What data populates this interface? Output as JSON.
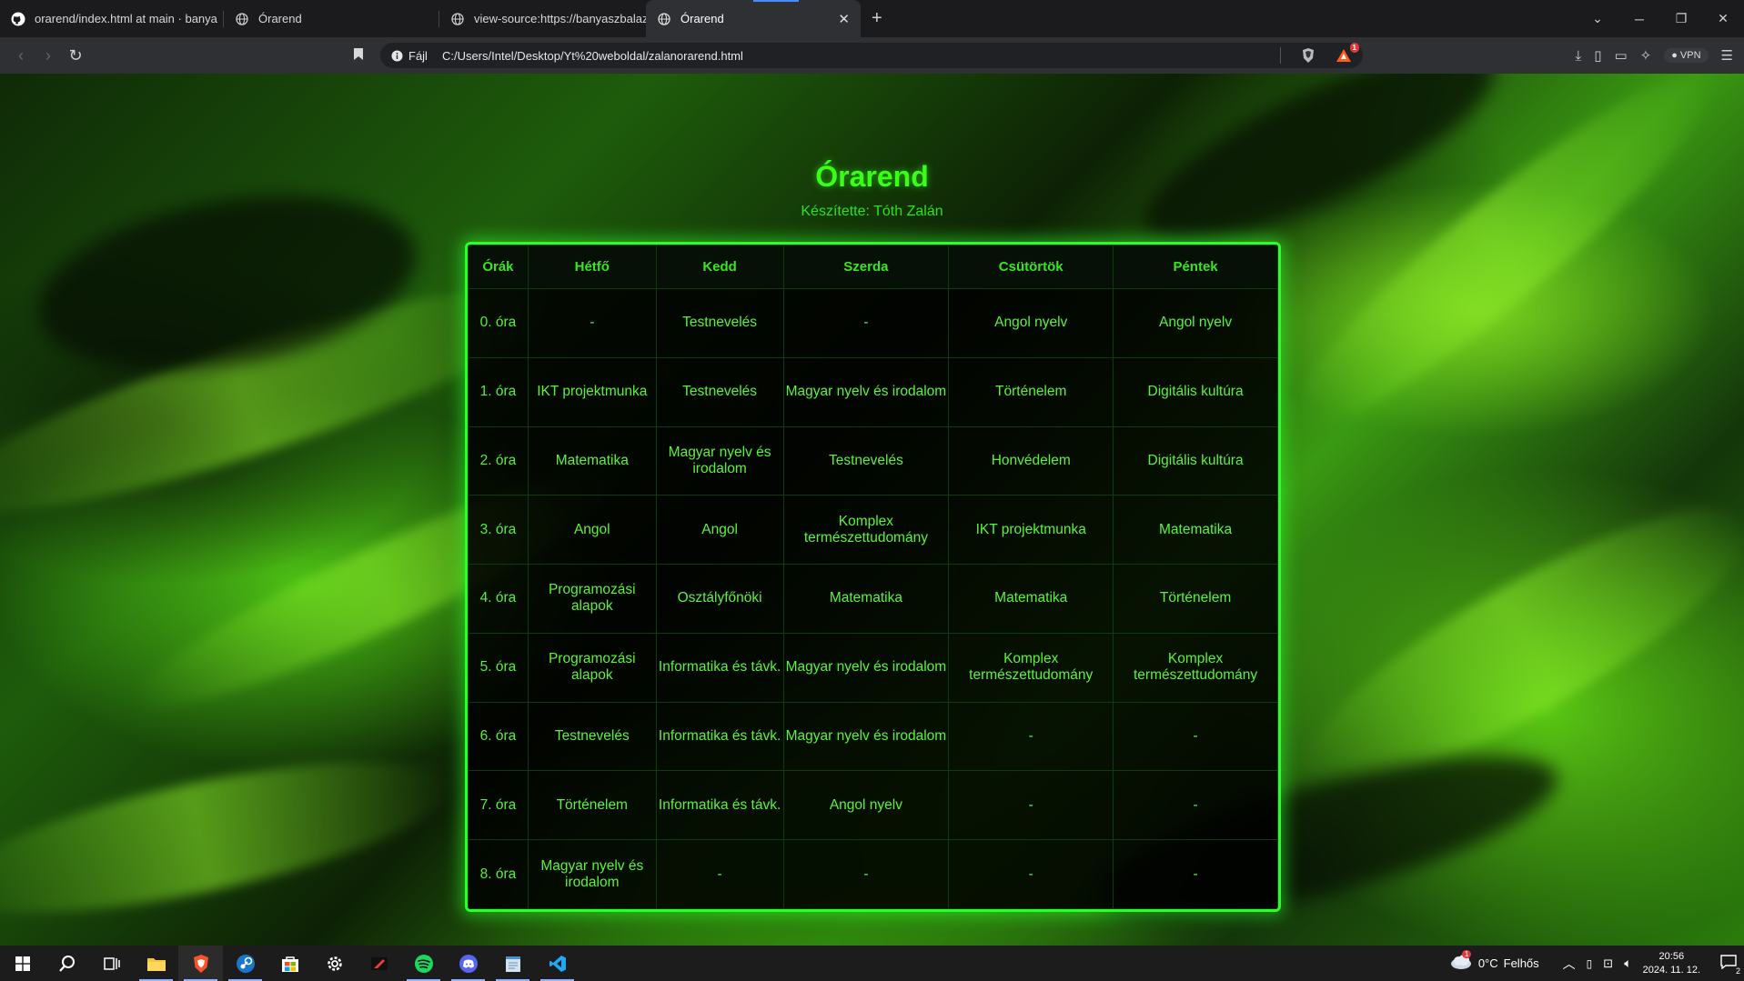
{
  "browser": {
    "tabs": [
      {
        "title": "orarend/index.html at main · banya",
        "icon": "github-icon",
        "active": false
      },
      {
        "title": "Órarend",
        "icon": "globe-icon",
        "active": false
      },
      {
        "title": "view-source:https://banyaszbalazs.g",
        "icon": "globe-icon",
        "active": false
      },
      {
        "title": "Órarend",
        "icon": "globe-icon",
        "active": true
      }
    ],
    "url_chip": "Fájl",
    "url": "C:/Users/Intel/Desktop/Yt%20weboldal/zalanorarend.html",
    "rewards_badge": "1",
    "vpn_label": "VPN"
  },
  "page": {
    "title": "Órarend",
    "subtitle": "Készítette: Tóth Zalán",
    "table": {
      "headers": [
        "Órák",
        "Hétfő",
        "Kedd",
        "Szerda",
        "Csütörtök",
        "Péntek"
      ],
      "rows": [
        [
          "0. óra",
          "-",
          "Testnevelés",
          "-",
          "Angol nyelv",
          "Angol nyelv"
        ],
        [
          "1. óra",
          "IKT projektmunka",
          "Testnevelés",
          "Magyar nyelv és irodalom",
          "Történelem",
          "Digitális kultúra"
        ],
        [
          "2. óra",
          "Matematika",
          "Magyar nyelv és irodalom",
          "Testnevelés",
          "Honvédelem",
          "Digitális kultúra"
        ],
        [
          "3. óra",
          "Angol",
          "Angol",
          "Komplex természettudomány",
          "IKT projektmunka",
          "Matematika"
        ],
        [
          "4. óra",
          "Programozási alapok",
          "Osztályfőnöki",
          "Matematika",
          "Matematika",
          "Történelem"
        ],
        [
          "5. óra",
          "Programozási alapok",
          "Informatika és távk.",
          "Magyar nyelv és irodalom",
          "Komplex természettudomány",
          "Komplex természettudomány"
        ],
        [
          "6. óra",
          "Testnevelés",
          "Informatika és távk.",
          "Magyar nyelv és irodalom",
          "-",
          "-"
        ],
        [
          "7. óra",
          "Történelem",
          "Informatika és távk.",
          "Angol nyelv",
          "-",
          "-"
        ],
        [
          "8. óra",
          "Magyar nyelv és irodalom",
          "-",
          "-",
          "-",
          "-"
        ]
      ]
    }
  },
  "taskbar": {
    "weather_temp": "0°C",
    "weather_text": "Felhős",
    "weather_badge": "1",
    "time": "20:56",
    "date": "2024. 11. 12.",
    "notifications": "2"
  },
  "colors": {
    "accent_green": "#39ff14",
    "table_border": "#2bff2b"
  }
}
